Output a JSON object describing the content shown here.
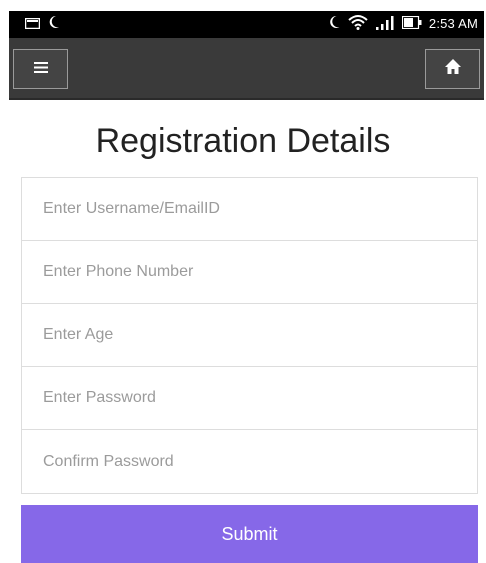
{
  "status_bar": {
    "time": "2:53 AM",
    "icons": [
      "message-icon",
      "moon-icon",
      "moon-icon",
      "wifi-icon",
      "signal-icon",
      "battery-icon"
    ]
  },
  "toolbar": {
    "menu_icon": "hamburger-menu-icon",
    "home_icon": "home-icon"
  },
  "page": {
    "title": "Registration Details"
  },
  "form": {
    "fields": [
      {
        "placeholder": "Enter Username/EmailID",
        "value": ""
      },
      {
        "placeholder": "Enter Phone Number",
        "value": ""
      },
      {
        "placeholder": "Enter Age",
        "value": ""
      },
      {
        "placeholder": "Enter Password",
        "value": ""
      },
      {
        "placeholder": "Confirm Password",
        "value": ""
      }
    ],
    "submit_label": "Submit"
  },
  "colors": {
    "accent": "#8668e8",
    "toolbar": "#3a3a3a",
    "status_bar": "#000000"
  }
}
